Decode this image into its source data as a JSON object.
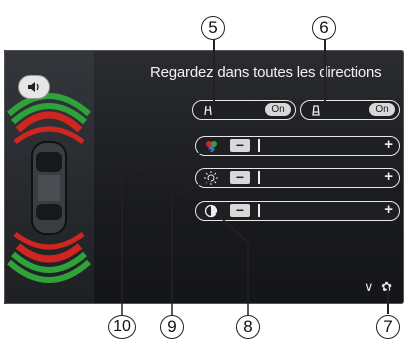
{
  "header": {
    "title": "Regardez dans toutes les directions"
  },
  "toggles": [
    {
      "id": "toggle-5",
      "icon": "camera-lines-icon",
      "state": "On"
    },
    {
      "id": "toggle-6",
      "icon": "camera-trapezoid-icon",
      "state": "On"
    }
  ],
  "sliders": [
    {
      "id": "color",
      "icon": "color-dots-icon",
      "minus": "−",
      "plus": "+"
    },
    {
      "id": "brightness",
      "icon": "sun-icon",
      "minus": "−",
      "plus": "+"
    },
    {
      "id": "contrast",
      "icon": "contrast-icon",
      "minus": "−",
      "plus": "+"
    }
  ],
  "callouts": {
    "c5": "5",
    "c6": "6",
    "c7": "7",
    "c8": "8",
    "c9": "9",
    "c10": "10"
  },
  "bottom": {
    "chevron": "∨",
    "gear": "✿"
  },
  "colors": {
    "red": "#d0261f",
    "green": "#2fa23a",
    "accent": "#e8e8e8"
  }
}
